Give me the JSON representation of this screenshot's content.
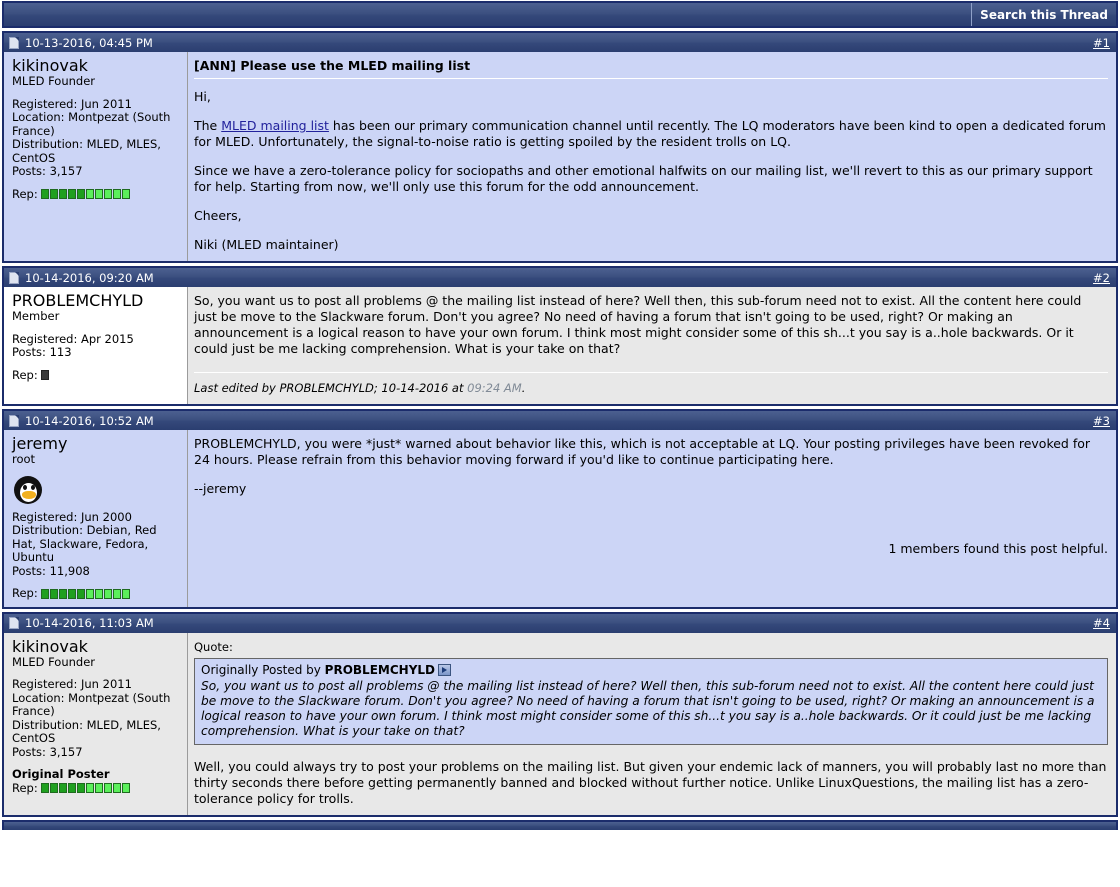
{
  "toolbar": {
    "search_thread_label": "Search this Thread"
  },
  "posts": [
    {
      "date": "10-13-2016, 04:45 PM",
      "number": "#1",
      "user": {
        "name": "kikinovak",
        "title": "MLED Founder",
        "registered": "Registered: Jun 2011",
        "location": "Location: Montpezat (South France)",
        "distribution": "Distribution: MLED, MLES, CentOS",
        "posts": "Posts: 3,157",
        "rep_label": "Rep:",
        "op_label": ""
      },
      "title": "[ANN] Please use the MLED mailing list",
      "paragraphs": {
        "p1": "Hi,",
        "p2_pre": "The ",
        "p2_link": "MLED mailing list",
        "p2_post": " has been our primary communication channel until recently. The LQ moderators have been kind to open a dedicated forum for MLED. Unfortunately, the signal-to-noise ratio is getting spoiled by the resident trolls on LQ.",
        "p3": "Since we have a zero-tolerance policy for sociopaths and other emotional halfwits on our mailing list, we'll revert to this as our primary support for help. Starting from now, we'll only use this forum for the odd announcement.",
        "p4": "Cheers,",
        "p5": "Niki (MLED maintainer)"
      }
    },
    {
      "date": "10-14-2016, 09:20 AM",
      "number": "#2",
      "user": {
        "name": "PROBLEMCHYLD",
        "title": "Member",
        "registered": "Registered: Apr 2015",
        "posts": "Posts: 113",
        "rep_label": "Rep:"
      },
      "body": "So, you want us to post all problems @ the mailing list instead of here? Well then, this sub-forum need not to exist. All the content here could just be move to the Slackware forum. Don't you agree? No need of having a forum that isn't going to be used, right? Or making an announcement is a logical reason to have your own forum. I think most might consider some of this sh...t you say is a..hole backwards. Or it could just be me lacking comprehension. What is your take on that?",
      "lastedit_pre": "Last edited by PROBLEMCHYLD; 10-14-2016 at ",
      "lastedit_time": "09:24 AM",
      "lastedit_post": "."
    },
    {
      "date": "10-14-2016, 10:52 AM",
      "number": "#3",
      "user": {
        "name": "jeremy",
        "title": "root",
        "registered": "Registered: Jun 2000",
        "distribution": "Distribution: Debian, Red Hat, Slackware, Fedora, Ubuntu",
        "posts": "Posts: 11,908",
        "rep_label": "Rep:",
        "avatar": "penguin-avatar"
      },
      "body": "PROBLEMCHYLD, you were *just* warned about behavior like this, which is not acceptable at LQ. Your posting privileges have been revoked for 24 hours. Please refrain from this behavior moving forward if you'd like to continue participating here.",
      "signature": "--jeremy",
      "helpful": "1 members found this post helpful."
    },
    {
      "date": "10-14-2016, 11:03 AM",
      "number": "#4",
      "user": {
        "name": "kikinovak",
        "title": "MLED Founder",
        "registered": "Registered: Jun 2011",
        "location": "Location: Montpezat (South France)",
        "distribution": "Distribution: MLED, MLES, CentOS",
        "posts": "Posts: 3,157",
        "op_label": "Original Poster",
        "rep_label": "Rep:"
      },
      "quote_label": "Quote:",
      "quote_attrib_pre": "Originally Posted by ",
      "quote_attrib_name": "PROBLEMCHYLD",
      "quote_text": "So, you want us to post all problems @ the mailing list instead of here? Well then, this sub-forum need not to exist. All the content here could just be move to the Slackware forum. Don't you agree? No need of having a forum that isn't going to be used, right? Or making an announcement is a logical reason to have your own forum. I think most might consider some of this sh...t you say is a..hole backwards. Or it could just be me lacking comprehension. What is your take on that?",
      "body": "Well, you could always try to post your problems on the mailing list. But given your endemic lack of manners, you will probably last no more than thirty seconds there before getting permanently banned and blocked without further notice. Unlike LinuxQuestions, the mailing list has a zero-tolerance policy for trolls."
    }
  ],
  "colors": {
    "header_navy": "#2b3e70",
    "border_navy": "#1b2c6b",
    "post_lavender": "#ccd5f6",
    "post_gray": "#e8e8e8",
    "link_blue": "#22229c",
    "rep_green": "#1fa01f"
  }
}
